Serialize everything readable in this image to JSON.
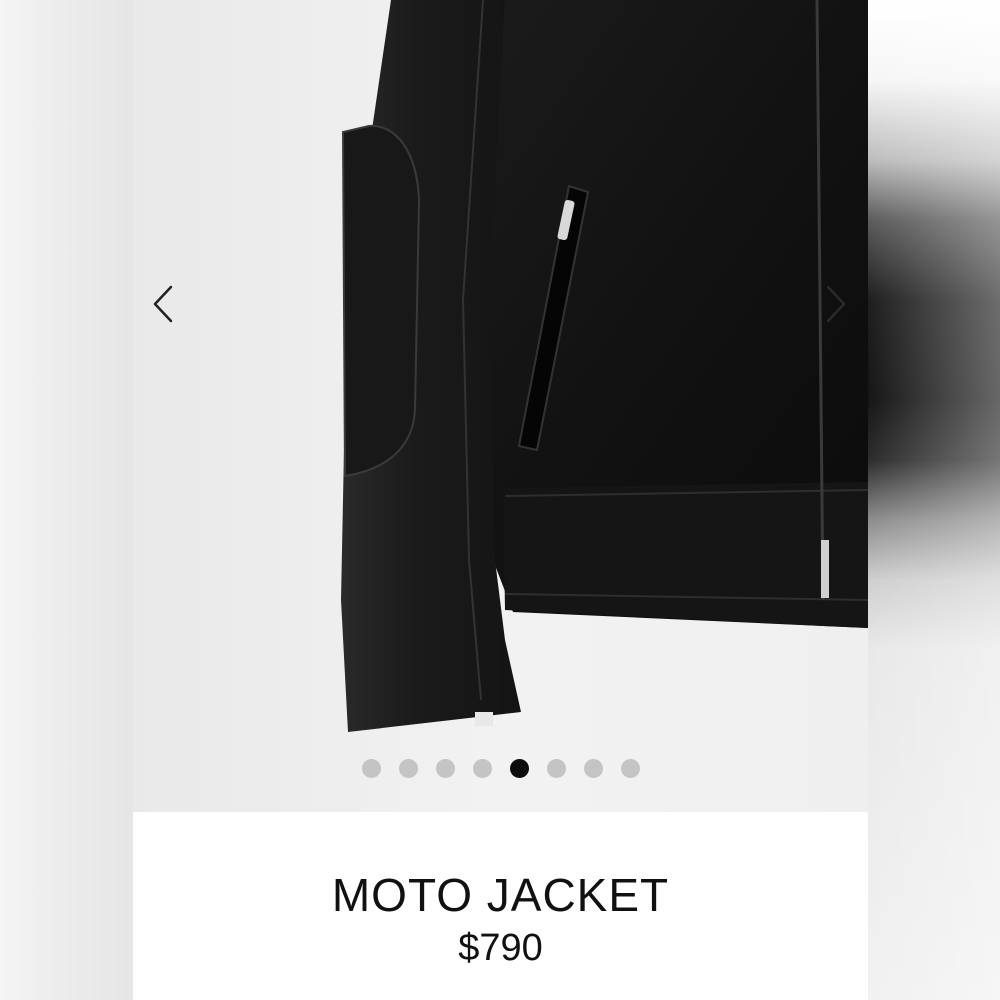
{
  "product": {
    "title": "MOTO JACKET",
    "price": "$790"
  },
  "carousel": {
    "image_subject": "black leather moto jacket detail",
    "total_images": 8,
    "active_index": 4,
    "prev_icon": "chevron-left-icon",
    "next_icon": "chevron-right-icon"
  },
  "colors": {
    "dot_inactive": "#c4c4c4",
    "dot_active": "#0d0d0d",
    "text": "#111111"
  }
}
